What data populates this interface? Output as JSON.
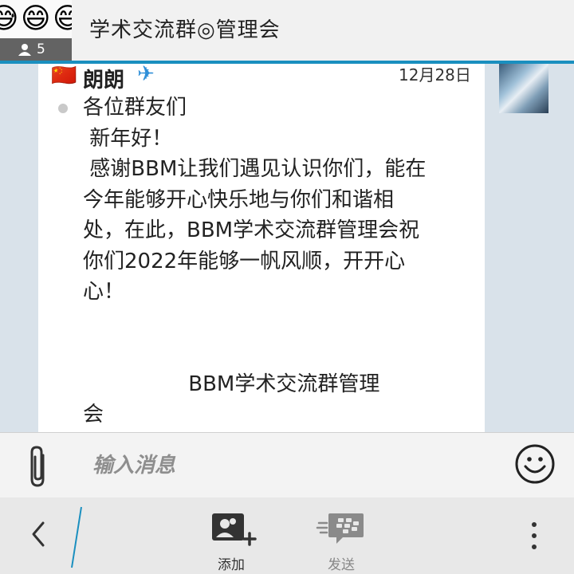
{
  "header": {
    "title": "学术交流群◎管理会",
    "member_count": "5",
    "avatar_emojis": [
      "😅",
      "😄",
      "😅"
    ]
  },
  "message": {
    "sender": "朗朗",
    "flag": "🇨🇳",
    "badge": "✈",
    "time": "12月28日",
    "text": "各位群友们\n 新年好！\n 感谢BBM让我们遇见认识你们，能在\n今年能够开心快乐地与你们和谐相\n处，在此，BBM学术交流群管理会祝\n你们2022年能够一帆风顺，开开心\n心！\n\n\n                BBM学术交流群管理\n会"
  },
  "composer": {
    "placeholder": "输入消息"
  },
  "nav": {
    "add_label": "添加",
    "send_label": "发送"
  },
  "colors": {
    "accent": "#1a8fbf",
    "header_bg": "#f1f1f1",
    "chat_bg": "#d9e2ea"
  }
}
